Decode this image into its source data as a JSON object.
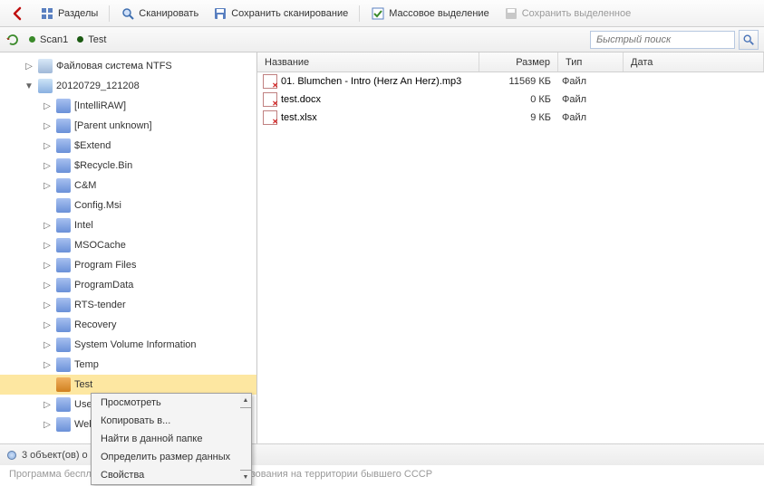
{
  "toolbar": {
    "back": "",
    "sections": "Разделы",
    "scan": "Сканировать",
    "save_scan": "Сохранить сканирование",
    "mass_select": "Массовое выделение",
    "save_selected": "Сохранить выделенное"
  },
  "tabs": {
    "scan1": "Scan1",
    "test": "Test"
  },
  "search": {
    "placeholder": "Быстрый поиск"
  },
  "tree": [
    {
      "label": "Файловая система NTFS",
      "indent": 1,
      "icon": "disk",
      "expander": "▷"
    },
    {
      "label": "20120729_121208",
      "indent": 1,
      "icon": "snap",
      "expander": "▼"
    },
    {
      "label": "[IntelliRAW]",
      "indent": 2,
      "icon": "folder",
      "expander": "▷"
    },
    {
      "label": "[Parent unknown]",
      "indent": 2,
      "icon": "folder",
      "expander": "▷"
    },
    {
      "label": "$Extend",
      "indent": 2,
      "icon": "folder",
      "expander": "▷"
    },
    {
      "label": "$Recycle.Bin",
      "indent": 2,
      "icon": "folder",
      "expander": "▷"
    },
    {
      "label": "C&M",
      "indent": 2,
      "icon": "folder",
      "expander": "▷"
    },
    {
      "label": "Config.Msi",
      "indent": 2,
      "icon": "folder",
      "expander": ""
    },
    {
      "label": "Intel",
      "indent": 2,
      "icon": "folder",
      "expander": "▷"
    },
    {
      "label": "MSOCache",
      "indent": 2,
      "icon": "folder",
      "expander": "▷"
    },
    {
      "label": "Program Files",
      "indent": 2,
      "icon": "folder",
      "expander": "▷"
    },
    {
      "label": "ProgramData",
      "indent": 2,
      "icon": "folder",
      "expander": "▷"
    },
    {
      "label": "RTS-tender",
      "indent": 2,
      "icon": "folder",
      "expander": "▷"
    },
    {
      "label": "Recovery",
      "indent": 2,
      "icon": "folder",
      "expander": "▷"
    },
    {
      "label": "System Volume Information",
      "indent": 2,
      "icon": "folder",
      "expander": "▷"
    },
    {
      "label": "Temp",
      "indent": 2,
      "icon": "folder",
      "expander": "▷"
    },
    {
      "label": "Test",
      "indent": 2,
      "icon": "folder-alt",
      "expander": "",
      "selected": true
    },
    {
      "label": "Use",
      "indent": 2,
      "icon": "folder",
      "expander": "▷",
      "cut": true
    },
    {
      "label": "Web",
      "indent": 2,
      "icon": "folder",
      "expander": "▷",
      "cut": true
    }
  ],
  "columns": {
    "name": "Название",
    "size": "Размер",
    "type": "Тип",
    "date": "Дата"
  },
  "files": [
    {
      "name": "01. Blumchen - Intro (Herz An Herz).mp3",
      "size": "11569 КБ",
      "type": "Файл"
    },
    {
      "name": "test.docx",
      "size": "0 КБ",
      "type": "Файл"
    },
    {
      "name": "test.xlsx",
      "size": "9 КБ",
      "type": "Файл"
    }
  ],
  "context_menu": [
    "Просмотреть",
    "Копировать в...",
    "Найти в данной папке",
    "Определить размер данных",
    "Свойства"
  ],
  "status": "3 объект(ов) о",
  "footer_partial_left": "Программа беспл",
  "footer_partial_right": "ьзования на территории бывшего СССР"
}
